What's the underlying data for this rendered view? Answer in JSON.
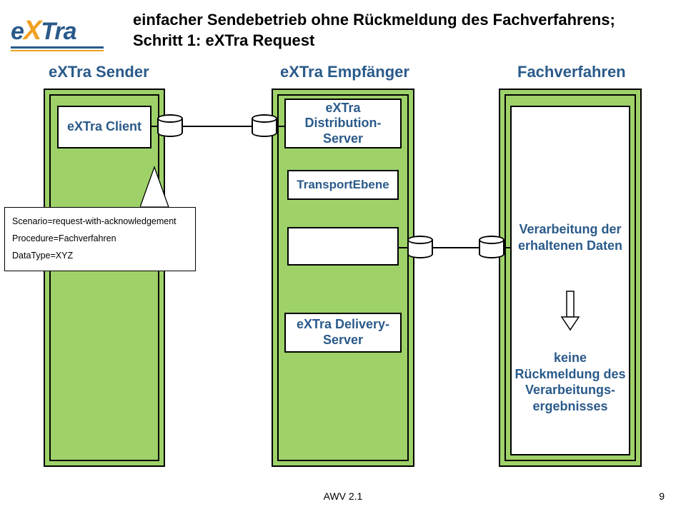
{
  "logo_text": {
    "e": "e",
    "x": "X",
    "tra": "Tra"
  },
  "title": "einfacher Sendebetrieb ohne Rückmeldung des Fachverfahrens; Schritt 1: eXTra Request",
  "columns": {
    "sender": "eXTra Sender",
    "empfaenger": "eXTra Empfänger",
    "fachverfahren": "Fachverfahren"
  },
  "boxes": {
    "client": "eXTra Client",
    "distribution": "eXTra Distribution-Server",
    "transport": "TransportEbene",
    "delivery": "eXTra Delivery-Server"
  },
  "fach": {
    "verarbeitung": "Verarbeitung der erhaltenen Daten",
    "keine": "keine Rückmeldung des Verarbeitungs-ergebnisses"
  },
  "scenario": {
    "line1": "Scenario=request-with-acknowledgement",
    "line2": "Procedure=Fachverfahren",
    "line3": "DataType=XYZ"
  },
  "footer": {
    "center": "AWV 2.1",
    "page": "9"
  }
}
